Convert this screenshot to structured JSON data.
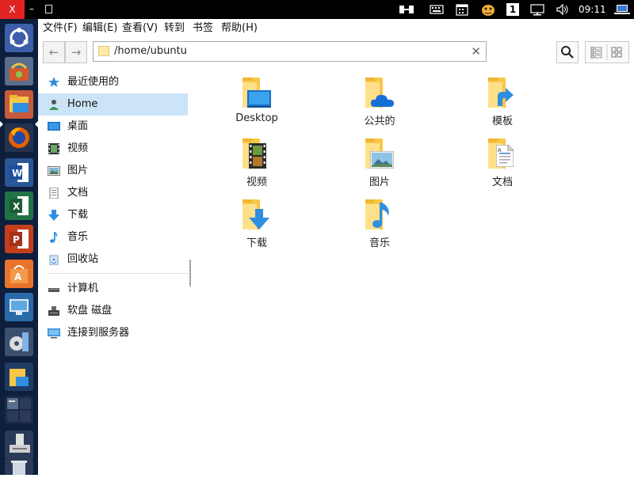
{
  "window": {
    "close_label": "X",
    "minimize_label": "–"
  },
  "tray": {
    "clock": "09:11",
    "workspace_number": "1"
  },
  "menu": {
    "items": [
      "文件(F)",
      "编辑(E)",
      "查看(V)",
      "转到",
      "书签",
      "帮助(H)"
    ]
  },
  "toolbar": {
    "path": "/home/ubuntu",
    "back_icon": "←",
    "forward_icon": "→",
    "clear_icon": "✕"
  },
  "sidebar": {
    "places": [
      {
        "label": "最近使用的",
        "icon": "star-icon"
      },
      {
        "label": "Home",
        "icon": "home-user-icon"
      },
      {
        "label": "桌面",
        "icon": "desktop-icon"
      },
      {
        "label": "视频",
        "icon": "video-icon"
      },
      {
        "label": "图片",
        "icon": "picture-icon"
      },
      {
        "label": "文档",
        "icon": "document-icon"
      },
      {
        "label": "下载",
        "icon": "download-icon"
      },
      {
        "label": "音乐",
        "icon": "music-icon"
      },
      {
        "label": "回收站",
        "icon": "trash-icon"
      }
    ],
    "devices": [
      {
        "label": "计算机",
        "icon": "computer-icon"
      },
      {
        "label": "软盘 磁盘",
        "icon": "floppy-icon"
      },
      {
        "label": "连接到服务器",
        "icon": "server-icon"
      }
    ]
  },
  "files": [
    {
      "label": "Desktop",
      "icon": "desktop-folder-icon"
    },
    {
      "label": "公共的",
      "icon": "public-folder-icon"
    },
    {
      "label": "模板",
      "icon": "templates-folder-icon"
    },
    {
      "label": "视频",
      "icon": "videos-folder-icon"
    },
    {
      "label": "图片",
      "icon": "pictures-folder-icon"
    },
    {
      "label": "文档",
      "icon": "documents-folder-icon"
    },
    {
      "label": "下载",
      "icon": "downloads-folder-icon"
    },
    {
      "label": "音乐",
      "icon": "music-folder-icon"
    }
  ],
  "colors": {
    "selection": "#cce4f7",
    "folder": "#f8c748",
    "launcher_bg": "#0d1f3c",
    "close_red": "#e02424",
    "accent_blue": "#2f8ee0"
  }
}
